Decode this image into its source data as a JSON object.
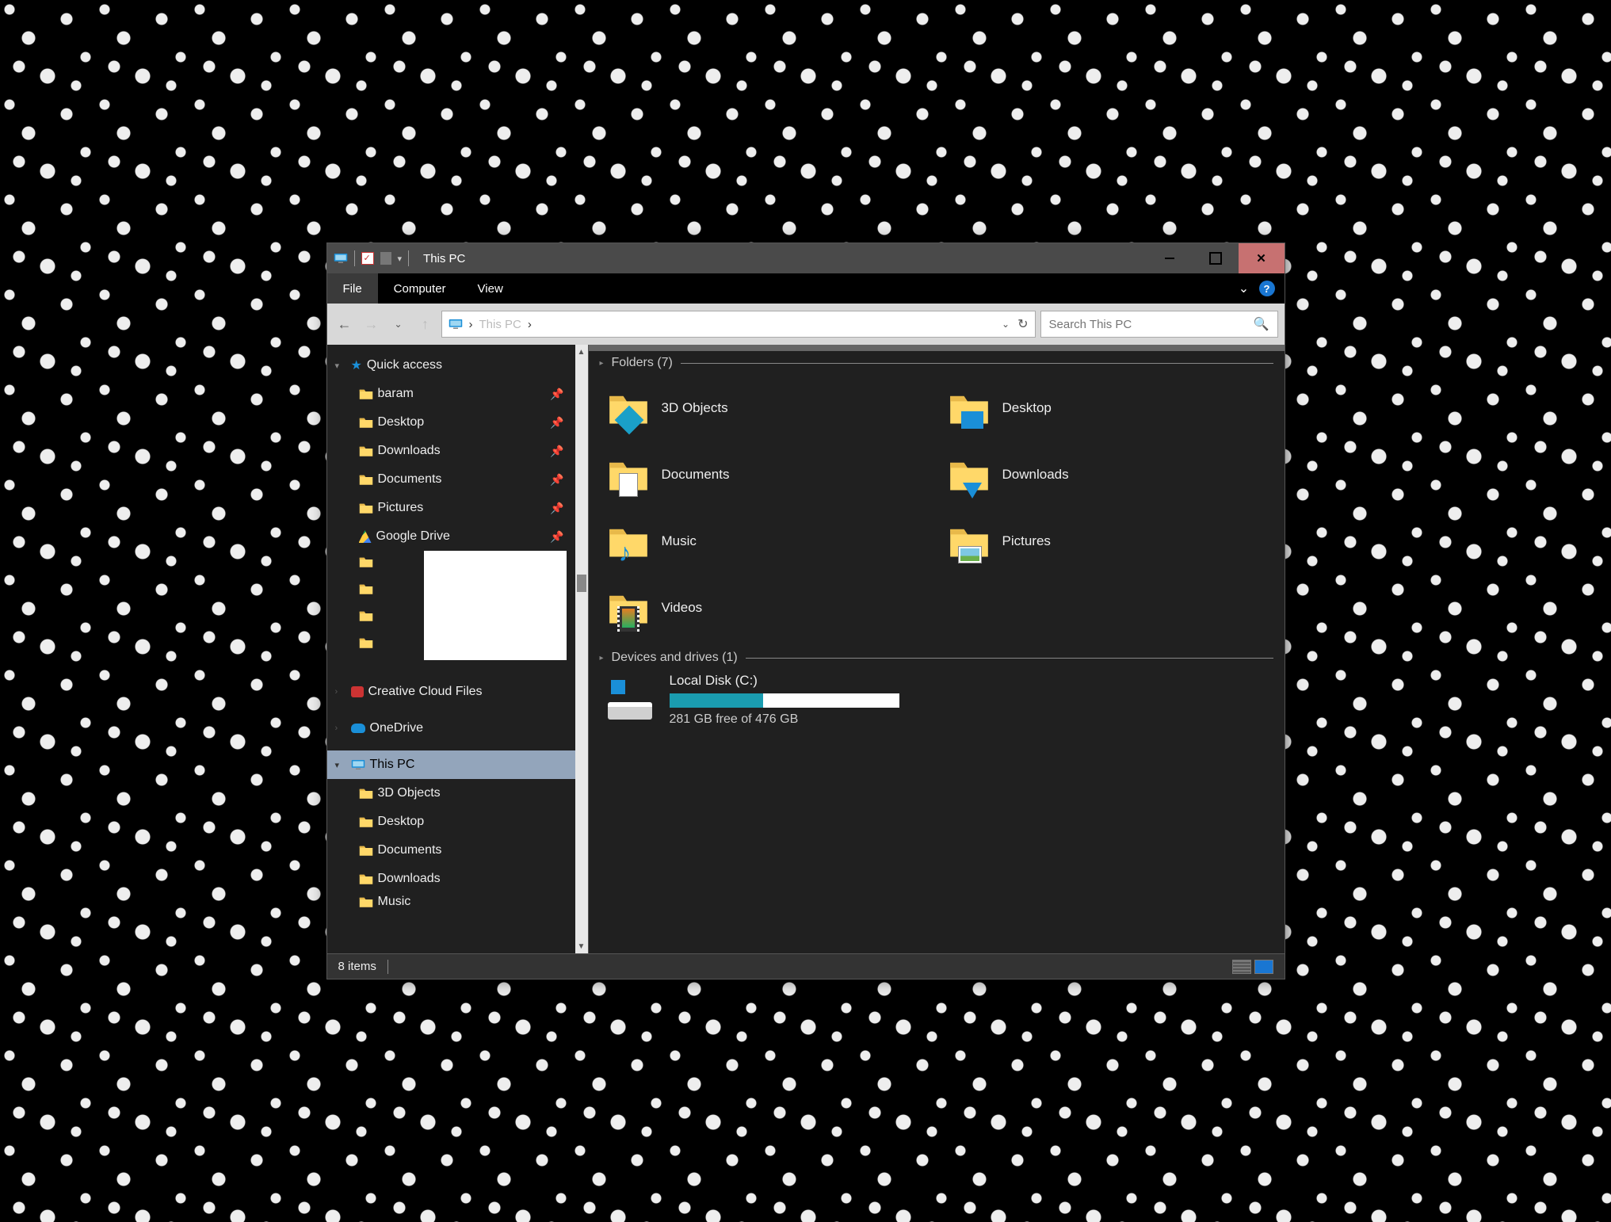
{
  "window": {
    "title": "This PC"
  },
  "ribbon": {
    "file": "File",
    "tabs": [
      "Computer",
      "View"
    ]
  },
  "address": {
    "crumb_root": "›",
    "crumb_label": "This PC",
    "crumb_sep": "›"
  },
  "search": {
    "placeholder": "Search This PC"
  },
  "sidebar": {
    "quick_access": "Quick access",
    "pinned": [
      {
        "label": "baram"
      },
      {
        "label": "Desktop"
      },
      {
        "label": "Downloads"
      },
      {
        "label": "Documents"
      },
      {
        "label": "Pictures"
      },
      {
        "label": "Google Drive"
      }
    ],
    "creative_cloud": "Creative Cloud Files",
    "onedrive": "OneDrive",
    "this_pc": "This PC",
    "this_pc_children": [
      "3D Objects",
      "Desktop",
      "Documents",
      "Downloads",
      "Music"
    ]
  },
  "main": {
    "folders_header": "Folders (7)",
    "folders": [
      "3D Objects",
      "Desktop",
      "Documents",
      "Downloads",
      "Music",
      "Pictures",
      "Videos"
    ],
    "drives_header": "Devices and drives (1)",
    "drive": {
      "name": "Local Disk (C:)",
      "free_text": "281 GB free of 476 GB",
      "used_pct": 41
    }
  },
  "status": {
    "items": "8 items"
  }
}
